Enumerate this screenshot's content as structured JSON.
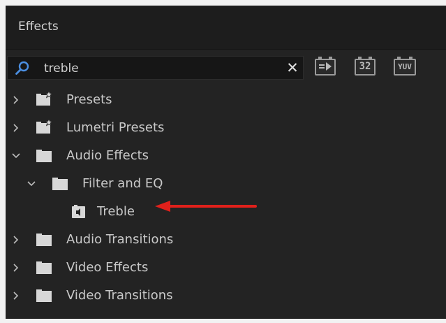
{
  "panel": {
    "title": "Effects"
  },
  "search": {
    "value": "treble",
    "icons": [
      "search-icon",
      "close-icon"
    ]
  },
  "filters": [
    {
      "label": "",
      "icon": "accelerated-effects-icon"
    },
    {
      "label": "32",
      "icon": "32-bit-color-icon"
    },
    {
      "label": "YUV",
      "icon": "yuv-effects-icon"
    }
  ],
  "tree": [
    {
      "label": "Presets",
      "level": 0,
      "expanded": false,
      "type": "preset-bin"
    },
    {
      "label": "Lumetri Presets",
      "level": 0,
      "expanded": false,
      "type": "preset-bin"
    },
    {
      "label": "Audio Effects",
      "level": 0,
      "expanded": true,
      "type": "folder"
    },
    {
      "label": "Filter and EQ",
      "level": 1,
      "expanded": true,
      "type": "folder"
    },
    {
      "label": "Treble",
      "level": 2,
      "type": "effect"
    },
    {
      "label": "Audio Transitions",
      "level": 0,
      "expanded": false,
      "type": "folder"
    },
    {
      "label": "Video Effects",
      "level": 0,
      "expanded": false,
      "type": "folder"
    },
    {
      "label": "Video Transitions",
      "level": 0,
      "expanded": false,
      "type": "folder"
    }
  ],
  "colors": {
    "panel_bg": "#232323",
    "header_bg": "#1d1d1d",
    "text": "#c9c9c9",
    "search_accent": "#4b8fe2",
    "annotation_arrow": "#e0201b"
  }
}
